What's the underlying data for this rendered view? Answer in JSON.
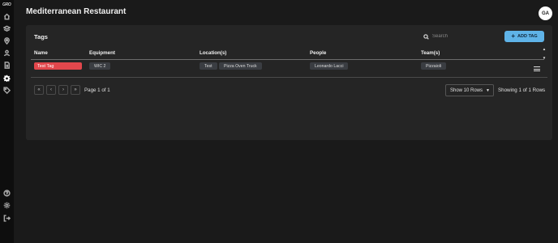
{
  "sidebar": {
    "logo_text": "GRO",
    "items": [
      {
        "icon": "home-icon"
      },
      {
        "icon": "layers-icon"
      },
      {
        "icon": "location-pin-icon"
      },
      {
        "icon": "user-icon"
      },
      {
        "icon": "document-icon"
      },
      {
        "icon": "gear-icon"
      },
      {
        "icon": "tag-icon"
      }
    ],
    "bottom_items": [
      {
        "icon": "help-icon"
      },
      {
        "icon": "settings-icon"
      },
      {
        "icon": "logout-icon"
      }
    ]
  },
  "header": {
    "title": "Mediterranean Restaurant",
    "avatar_initials": "GA"
  },
  "card": {
    "title": "Tags",
    "search_placeholder": "Search",
    "add_button_label": "ADD TAG",
    "columns": [
      "Name",
      "Equipment",
      "Location(s)",
      "People",
      "Team(s)"
    ],
    "rows": [
      {
        "name": "Test Tag",
        "equipment": [
          "WIC 2"
        ],
        "locations": [
          "Test",
          "Pizza Oven Truck"
        ],
        "people": [
          "Leonardo Lacci"
        ],
        "teams": [
          "Pizzaioli"
        ]
      }
    ]
  },
  "pagination": {
    "page_text": "Page 1 of 1",
    "rows_select_value": "Show 10 Rows",
    "showing_text": "Showing 1 of 1 Rows"
  },
  "colors": {
    "background": "#1a1a1a",
    "card": "#252525",
    "sidebar": "#0e0e0e",
    "accent": "#5fb3e8",
    "tag_red": "#e2474c",
    "chip": "#3a3d42"
  }
}
